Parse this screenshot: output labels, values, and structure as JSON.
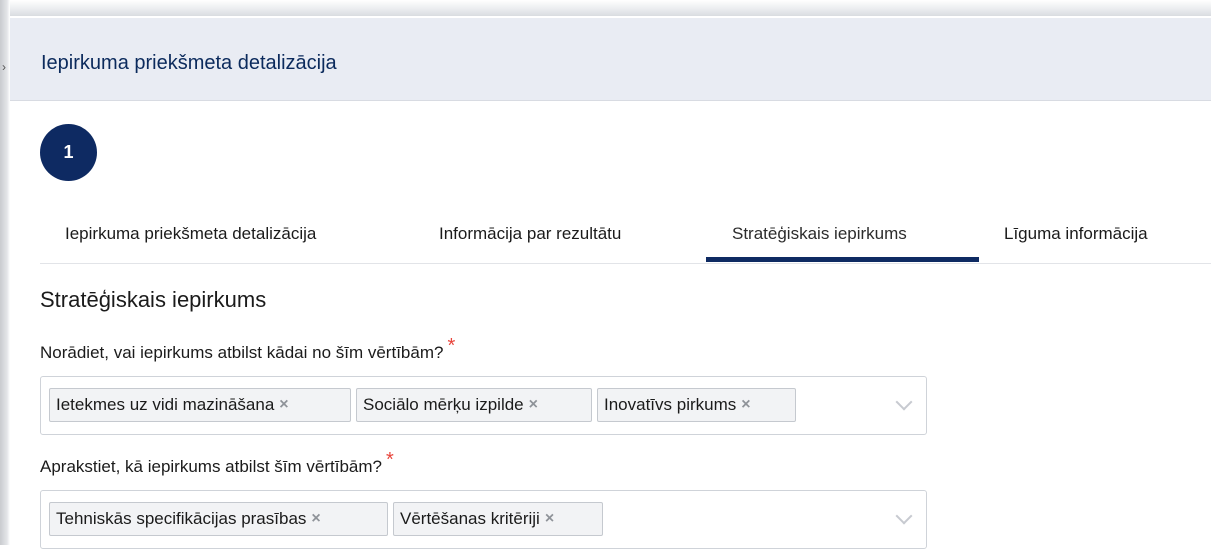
{
  "header": {
    "title": "Iepirkuma priekšmeta detalizācija"
  },
  "step": {
    "number": "1"
  },
  "tabs": [
    {
      "label": "Iepirkuma priekšmeta detalizācija"
    },
    {
      "label": "Informācija par rezultātu"
    },
    {
      "label": "Stratēģiskais iepirkums",
      "active": true
    },
    {
      "label": "Līguma informācija"
    }
  ],
  "section": {
    "title": "Stratēģiskais iepirkums",
    "q1": {
      "label": "Norādiet, vai iepirkums atbilst kādai no šīm vērtībām?",
      "required": "*",
      "chips": [
        "Ietekmes uz vidi mazināšana",
        "Sociālo mērķu izpilde",
        "Inovatīvs pirkums"
      ]
    },
    "q2": {
      "label": "Aprakstiet, kā iepirkums atbilst šīm vērtībām?",
      "required": "*",
      "chips": [
        "Tehniskās specifikācijas prasības",
        "Vērtēšanas kritēriji"
      ]
    }
  },
  "icons": {
    "remove": "×",
    "dropdown": "chevron-down-icon"
  },
  "colors": {
    "accent": "#0e2a62",
    "required": "#e8453c",
    "header_bg": "#e9ecf3"
  }
}
